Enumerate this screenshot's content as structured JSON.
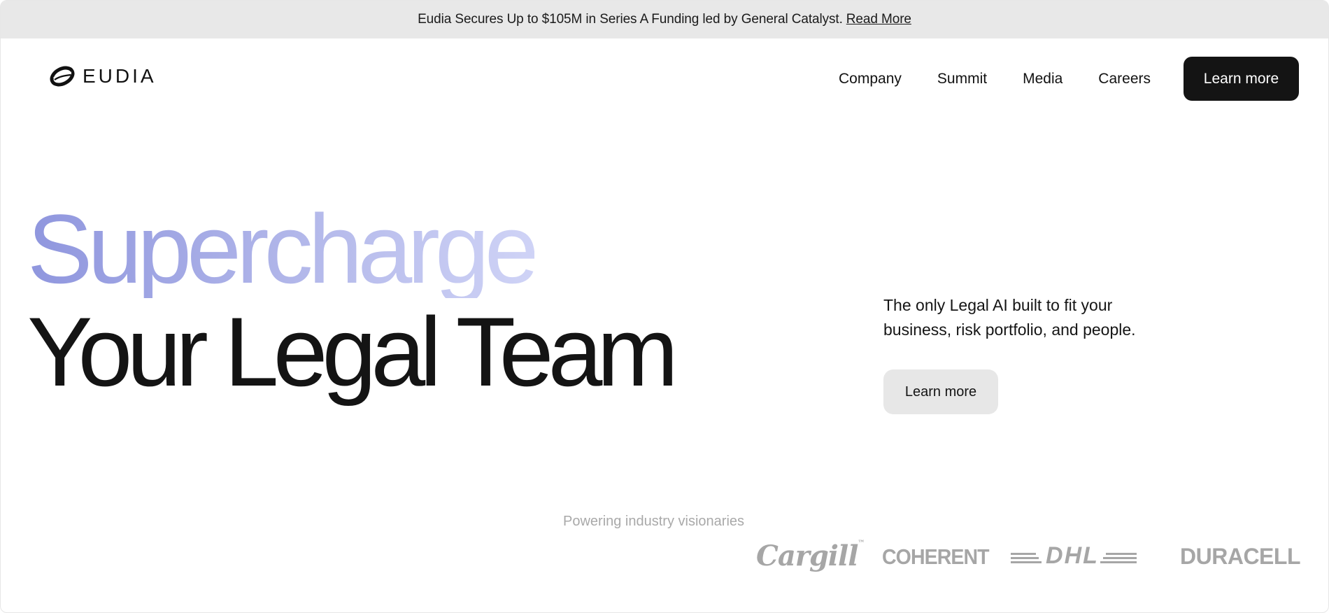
{
  "announcement": {
    "text": "Eudia Secures Up to $105M in Series A Funding led by General Catalyst.",
    "link_label": "Read More"
  },
  "header": {
    "brand": "EUDIA",
    "nav": [
      {
        "label": "Company"
      },
      {
        "label": "Summit"
      },
      {
        "label": "Media"
      },
      {
        "label": "Careers"
      }
    ],
    "cta_label": "Learn more"
  },
  "hero": {
    "headline_accent": "Supercharge",
    "headline_main": "Your Legal Team",
    "description": "The only Legal AI built to fit your business, risk portfolio, and people.",
    "cta_label": "Learn more"
  },
  "partners": {
    "caption": "Powering industry visionaries",
    "logos": [
      {
        "name": "Cargill"
      },
      {
        "name": "COHERENT"
      },
      {
        "name": "DHL"
      },
      {
        "name": "DURACELL"
      }
    ]
  },
  "colors": {
    "accent_gradient_start": "#8f96de",
    "accent_gradient_end": "#cfd3f6",
    "primary_button": "#141414",
    "secondary_button": "#e7e7e7",
    "announcement_bg": "#e8e8e8",
    "logo_gray": "#a6a6a6"
  },
  "icons": {
    "brand_mark": "eudia-logo-icon"
  }
}
